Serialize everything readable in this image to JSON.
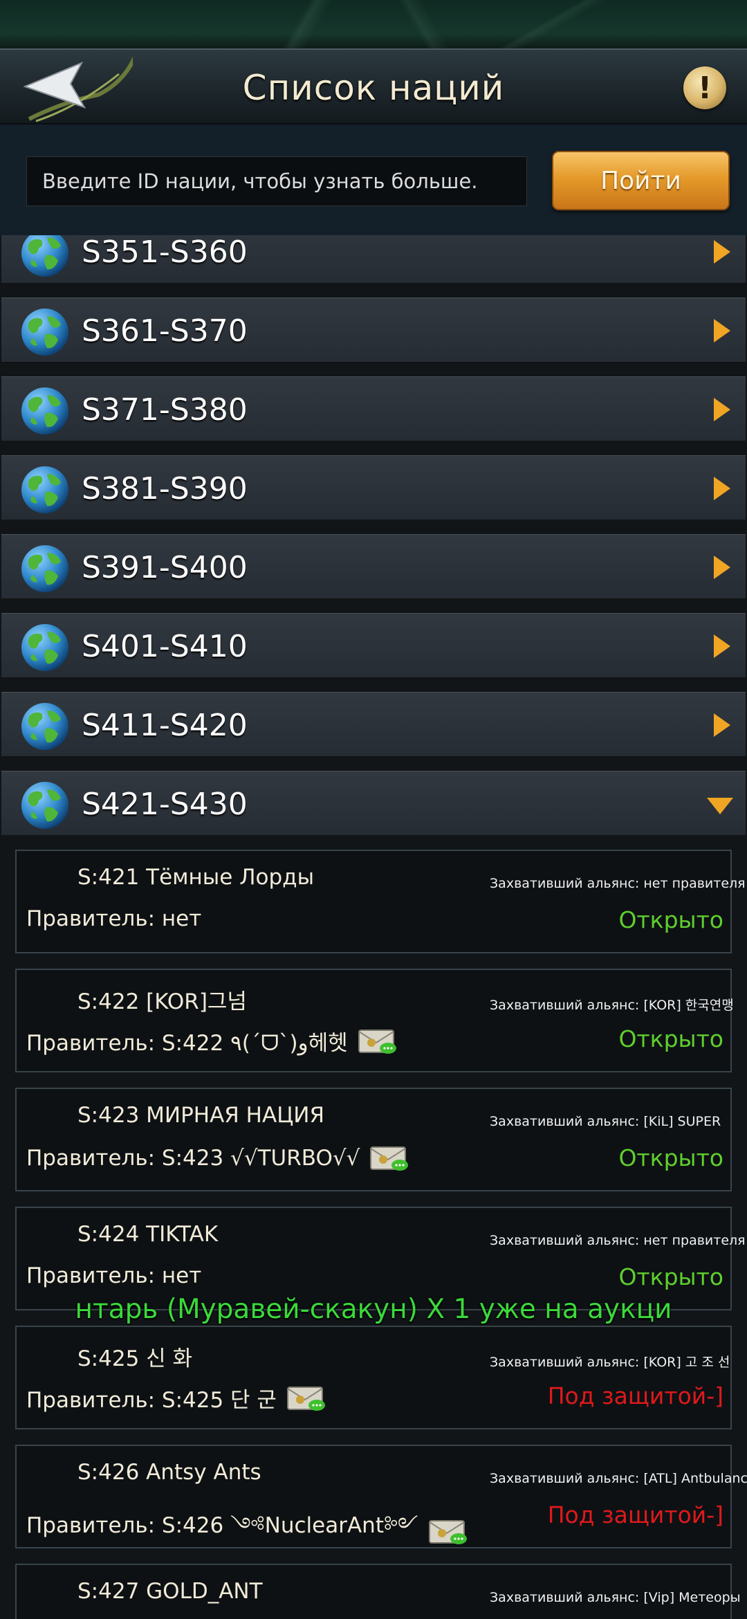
{
  "header": {
    "title": "Список наций",
    "info_label": "!"
  },
  "search": {
    "placeholder": "Введите ID нации, чтобы узнать больше.",
    "go_label": "Пойти"
  },
  "groups_collapsed": [
    {
      "label": "S351-S360"
    },
    {
      "label": "S361-S370"
    },
    {
      "label": "S371-S380"
    },
    {
      "label": "S381-S390"
    },
    {
      "label": "S391-S400"
    },
    {
      "label": "S401-S410"
    },
    {
      "label": "S411-S420"
    }
  ],
  "group_expanded": {
    "label": "S421-S430"
  },
  "nations": [
    {
      "name": "S:421 Тёмные Лорды",
      "alliance": "Захвативший альянс: нет правителя",
      "ruler": "Правитель: нет",
      "mail": false,
      "status": "Открыто",
      "status_type": "open"
    },
    {
      "name": "S:422 [KOR]그넘",
      "alliance": "Захвативший альянс: [KOR] 한국연맹",
      "ruler": "Правитель: S:422 ٩(ˊᗜˋ)و헤헷",
      "mail": true,
      "status": "Открыто",
      "status_type": "open"
    },
    {
      "name": "S:423 МИРНАЯ НАЦИЯ",
      "alliance": "Захвативший альянс: [KiL] SUPER",
      "ruler": "Правитель: S:423 √√TURBO√√",
      "mail": true,
      "status": "Открыто",
      "status_type": "open"
    },
    {
      "name": "S:424 TIKTAK",
      "alliance": "Захвативший альянс: нет правителя",
      "ruler": "Правитель: нет",
      "mail": false,
      "status": "Открыто",
      "status_type": "open"
    },
    {
      "name": "S:425 신 화",
      "alliance": "Захвативший альянс: [KOR] 고 조 선",
      "ruler": "Правитель: S:425 단 군",
      "mail": true,
      "status": "Под защитой-]",
      "status_type": "protected"
    },
    {
      "name": "S:426 Antsy Ants",
      "alliance": "Захвативший альянс: [ATL] Antbulance",
      "ruler": "Правитель: S:426 ༺NuclearAnt༻",
      "mail": true,
      "status": "Под защитой-]",
      "status_type": "protected"
    },
    {
      "name": "S:427 GOLD_ANT",
      "alliance": "Захвативший альянс: [Vip] Метеоры",
      "ruler": "",
      "mail": false,
      "status": "",
      "status_type": "open"
    }
  ],
  "ticker": {
    "text": "нтарь (Муравей-скакун) X 1 уже на аукци"
  },
  "colors": {
    "accent_orange": "#f0a524",
    "status_open": "#5fcf2e",
    "status_protected": "#e0191b"
  },
  "icons": {
    "back": "back-arrow-icon",
    "info": "exclamation-icon",
    "globe": "globe-icon",
    "expand": "chevron-right-icon",
    "collapse": "chevron-down-icon",
    "mail": "mail-icon"
  }
}
